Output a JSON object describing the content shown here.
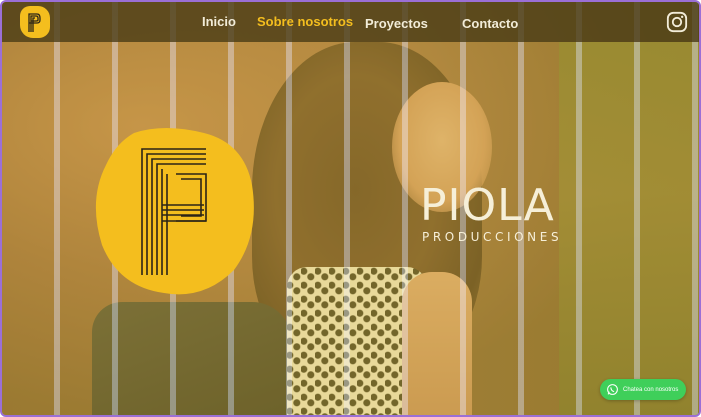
{
  "nav": {
    "items": [
      {
        "label": "Inicio",
        "active": false
      },
      {
        "label": "Sobre nosotros",
        "active": true
      },
      {
        "label": "Proyectos",
        "active": false
      },
      {
        "label": "Contacto",
        "active": false
      }
    ],
    "social_icon": "instagram-icon"
  },
  "brand": {
    "title": "PIOLA",
    "subtitle": "PRODUCCIONES"
  },
  "chat": {
    "label": "Chatea con nosotros",
    "icon": "whatsapp-icon"
  },
  "colors": {
    "accent": "#f4be1e",
    "nav_text": "#f2ecd8",
    "chat_green": "#3fcf5a"
  }
}
